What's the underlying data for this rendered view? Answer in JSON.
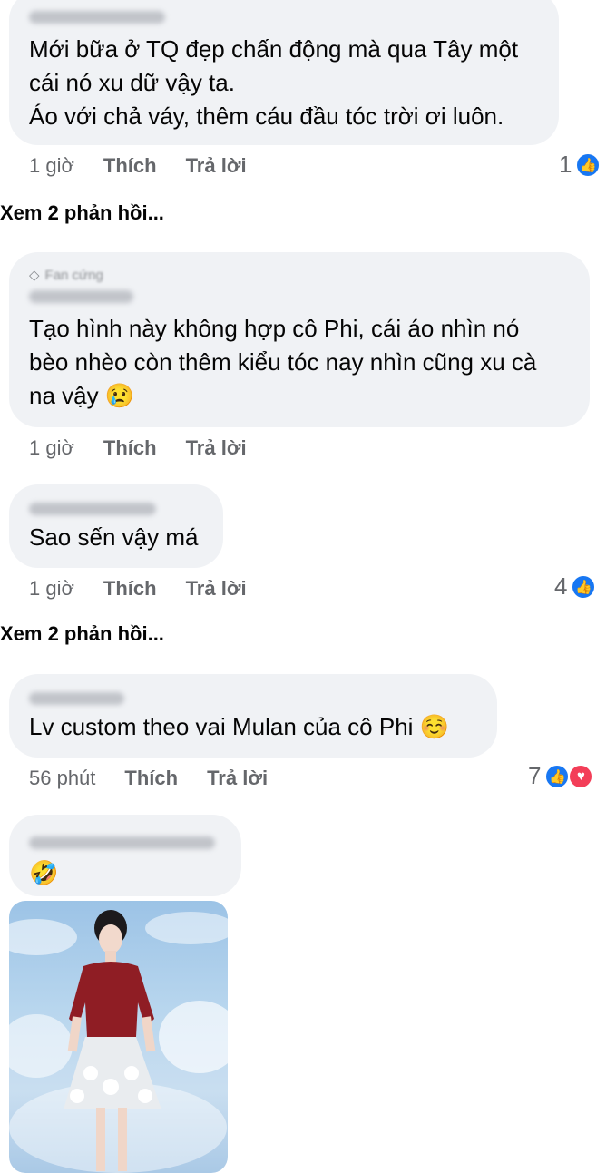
{
  "comments": [
    {
      "text_lines": [
        "Mới bữa ở TQ đẹp chấn động mà qua Tây một",
        "cái nó xu dữ vậy ta.",
        "Áo với chả váy, thêm cáu đầu tóc trời ơi luôn."
      ],
      "time": "1 giờ",
      "like_label": "Thích",
      "reply_label": "Trả lời",
      "reaction_count": "1",
      "view_replies": "Xem 2 phản hồi..."
    },
    {
      "badge": "Fan cứng",
      "text_lines": [
        "Tạo hình này không hợp cô Phi, cái áo nhìn nó",
        "bèo nhèo còn thêm kiểu tóc nay nhìn cũng xu cà",
        "na vậy"
      ],
      "emoji": "😢",
      "time": "1 giờ",
      "like_label": "Thích",
      "reply_label": "Trả lời"
    },
    {
      "text_lines": [
        "Sao sến vậy má"
      ],
      "time": "1 giờ",
      "like_label": "Thích",
      "reply_label": "Trả lời",
      "reaction_count": "4",
      "view_replies": "Xem 2 phản hồi..."
    },
    {
      "text_lines": [
        "Lv custom theo vai Mulan của cô Phi"
      ],
      "emoji": "☺️",
      "time": "56 phút",
      "like_label": "Thích",
      "reply_label": "Trả lời",
      "reaction_count": "7"
    },
    {
      "emoji": "🤣"
    }
  ],
  "icons": {
    "like": "like-icon",
    "love": "love-icon",
    "badge": "diamond-icon"
  },
  "colors": {
    "bubble": "#f0f2f5",
    "like_blue": "#1877f2",
    "love_red": "#f33e58",
    "meta_gray": "#65676b"
  }
}
